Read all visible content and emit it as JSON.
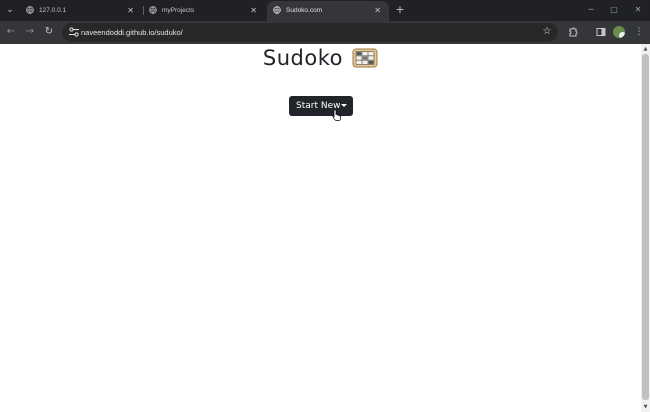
{
  "browser": {
    "tabs": [
      {
        "title": "127.0.0.1",
        "active": false
      },
      {
        "title": "myProjects",
        "active": false
      },
      {
        "title": "Sudoko.com",
        "active": true
      }
    ],
    "new_tab_symbol": "+",
    "url": "naveendoddi.github.io/suduko/",
    "window_controls": {
      "minimize": "─",
      "maximize": "▢",
      "close": "✕"
    }
  },
  "page": {
    "title": "Sudoko",
    "icon": "sudoku-grid-icon",
    "start_button_label": "Start New"
  },
  "colors": {
    "chrome_dark": "#202124",
    "toolbar": "#35363a",
    "button_bg": "#212529",
    "page_bg": "#ffffff"
  }
}
